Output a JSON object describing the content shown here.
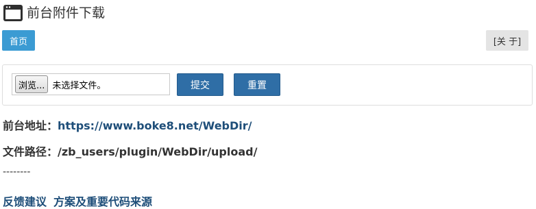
{
  "header": {
    "icon": "browser-window-icon",
    "title": "前台附件下载"
  },
  "nav": {
    "home_label": "首页",
    "about_label": "[关 于]"
  },
  "form": {
    "browse_label": "浏览...",
    "file_status": "未选择文件。",
    "submit_label": "提交",
    "reset_label": "重置"
  },
  "info": {
    "address_label": "前台地址：",
    "address_value": "https://www.boke8.net/WebDir/",
    "path_label": "文件路径：",
    "path_value": "/zb_users/plugin/WebDir/upload/"
  },
  "separator": "--------",
  "footer": {
    "feedback_label": "反馈建议",
    "source_label": "方案及重要代码来源"
  },
  "colors": {
    "home_button": "#3b9bd3",
    "primary_button": "#2f6ea6",
    "link": "#1e4e79",
    "about_button": "#e4e4e4"
  }
}
